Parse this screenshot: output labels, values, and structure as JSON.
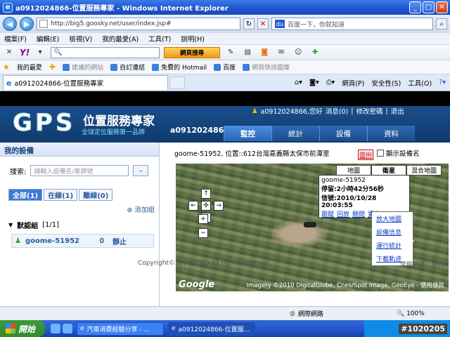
{
  "window": {
    "title": "a0912024866-位置服務專家 - Windows Internet Explorer"
  },
  "address": {
    "url": "http://big5.goosky.net/user/index.jsp#"
  },
  "search_box": {
    "placeholder": "百度一下，你就知道"
  },
  "menu": [
    "檔案(F)",
    "編輯(E)",
    "檢視(V)",
    "我的最愛(A)",
    "工具(T)",
    "說明(H)"
  ],
  "yahoo_toolbar": {
    "logo": "Y!",
    "search_button": "網頁搜尋"
  },
  "favorites": {
    "label": "我的最愛",
    "items": [
      {
        "label": "建議的網站",
        "dim": true
      },
      {
        "label": "自訂連結",
        "dim": false
      },
      {
        "label": "免費的 Hotmail",
        "dim": false
      },
      {
        "label": "百度",
        "dim": false
      },
      {
        "label": "網頁快訊圖庫",
        "dim": true
      }
    ]
  },
  "browser_tab": {
    "label": "a0912024866-位置服務專家"
  },
  "command_bar": {
    "page": "網頁(P)",
    "safety": "安全性(S)",
    "tools": "工具(O)"
  },
  "gps": {
    "logo": "GPS",
    "title": "位置服務專家",
    "slogan": "全球定位服務第一品牌",
    "account": "a0912024866",
    "user_greeting": "a0912024866,您好",
    "messages": "消息(0)",
    "change_password": "修改密碼",
    "logout": "退出",
    "sep": "|",
    "nav": [
      {
        "label": "監控",
        "active": true
      },
      {
        "label": "統計",
        "active": false
      },
      {
        "label": "設備",
        "active": false
      },
      {
        "label": "資料",
        "active": false
      }
    ]
  },
  "devices_panel": {
    "title": "我的設備",
    "search_label": "搜索:",
    "search_placeholder": "請輸入設備名/車牌號",
    "search_btn": "¥",
    "filters": [
      {
        "label": "全部(1)",
        "active": true
      },
      {
        "label": "在線(1)",
        "active": false
      },
      {
        "label": "離線(0)",
        "active": false
      }
    ],
    "add_group": "添加組",
    "group": {
      "name": "默認組",
      "count": "[1/1]"
    },
    "device": {
      "name": "goome-51952",
      "value": "0",
      "status": "靜止"
    }
  },
  "map_panel": {
    "info": "goome-51952, 位置::612台灣嘉義縣太保市前潭里",
    "legend": "圖例",
    "show_names": "顯示設備名",
    "map_types": [
      {
        "label": "地圖",
        "active": false
      },
      {
        "label": "衛星",
        "active": true
      },
      {
        "label": "混合地圖",
        "active": false
      }
    ],
    "popup": {
      "name": "goome-51952",
      "stop": "停留:2小時42分56秒",
      "signal": "信號:2010/10/28 20:03:55",
      "links": [
        "跟蹤",
        "回放",
        "關閉",
        "更多"
      ]
    },
    "context_menu": [
      "放大地圖",
      "設備信息",
      "運行統計",
      "下載軌迹"
    ],
    "pan_up": "↑",
    "pan_left": "←",
    "pan_center": "✣",
    "pan_right": "→",
    "pan_down": "↓",
    "zoom_in": "+",
    "zoom_out": "−",
    "google": "Google",
    "imagery": "Imagery ©2010 DigitalGlobe, Cnes/Spot Image, GeoEye - 使用條款"
  },
  "footer": {
    "copyright": "Copyright©2008-2010 All rights reserved.",
    "network": "電腦網速：很好"
  },
  "statusbar": {
    "zone": "網際網路",
    "zoom": "100%"
  },
  "taskbar": {
    "start": "開始",
    "tasks": [
      {
        "label": "汽車消費經驗分享 - ...",
        "active": false
      },
      {
        "label": "a0912024866-位置服...",
        "active": true
      }
    ],
    "tag": "#1020205"
  }
}
